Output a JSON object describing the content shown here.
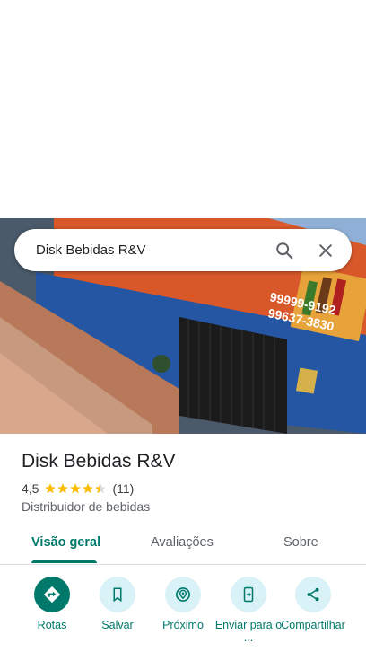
{
  "search": {
    "query": "Disk Bebidas R&V"
  },
  "photo": {
    "sign_phone_1": "99999-9192",
    "sign_phone_2": "99637-3830"
  },
  "place": {
    "name": "Disk Bebidas R&V",
    "rating": "4,5",
    "stars": 4.5,
    "review_count": "(11)",
    "category": "Distribuidor de bebidas"
  },
  "tabs": [
    {
      "label": "Visão geral",
      "active": true
    },
    {
      "label": "Avaliações",
      "active": false
    },
    {
      "label": "Sobre",
      "active": false
    }
  ],
  "actions": [
    {
      "label": "Rotas",
      "icon": "directions-icon"
    },
    {
      "label": "Salvar",
      "icon": "bookmark-icon"
    },
    {
      "label": "Próximo",
      "icon": "nearby-icon"
    },
    {
      "label": "Enviar para o ...",
      "icon": "send-to-phone-icon"
    },
    {
      "label": "Compartilhar",
      "icon": "share-icon"
    }
  ],
  "colors": {
    "accent": "#00796b",
    "star": "#fbbc04",
    "chip": "#d9f2f7"
  }
}
